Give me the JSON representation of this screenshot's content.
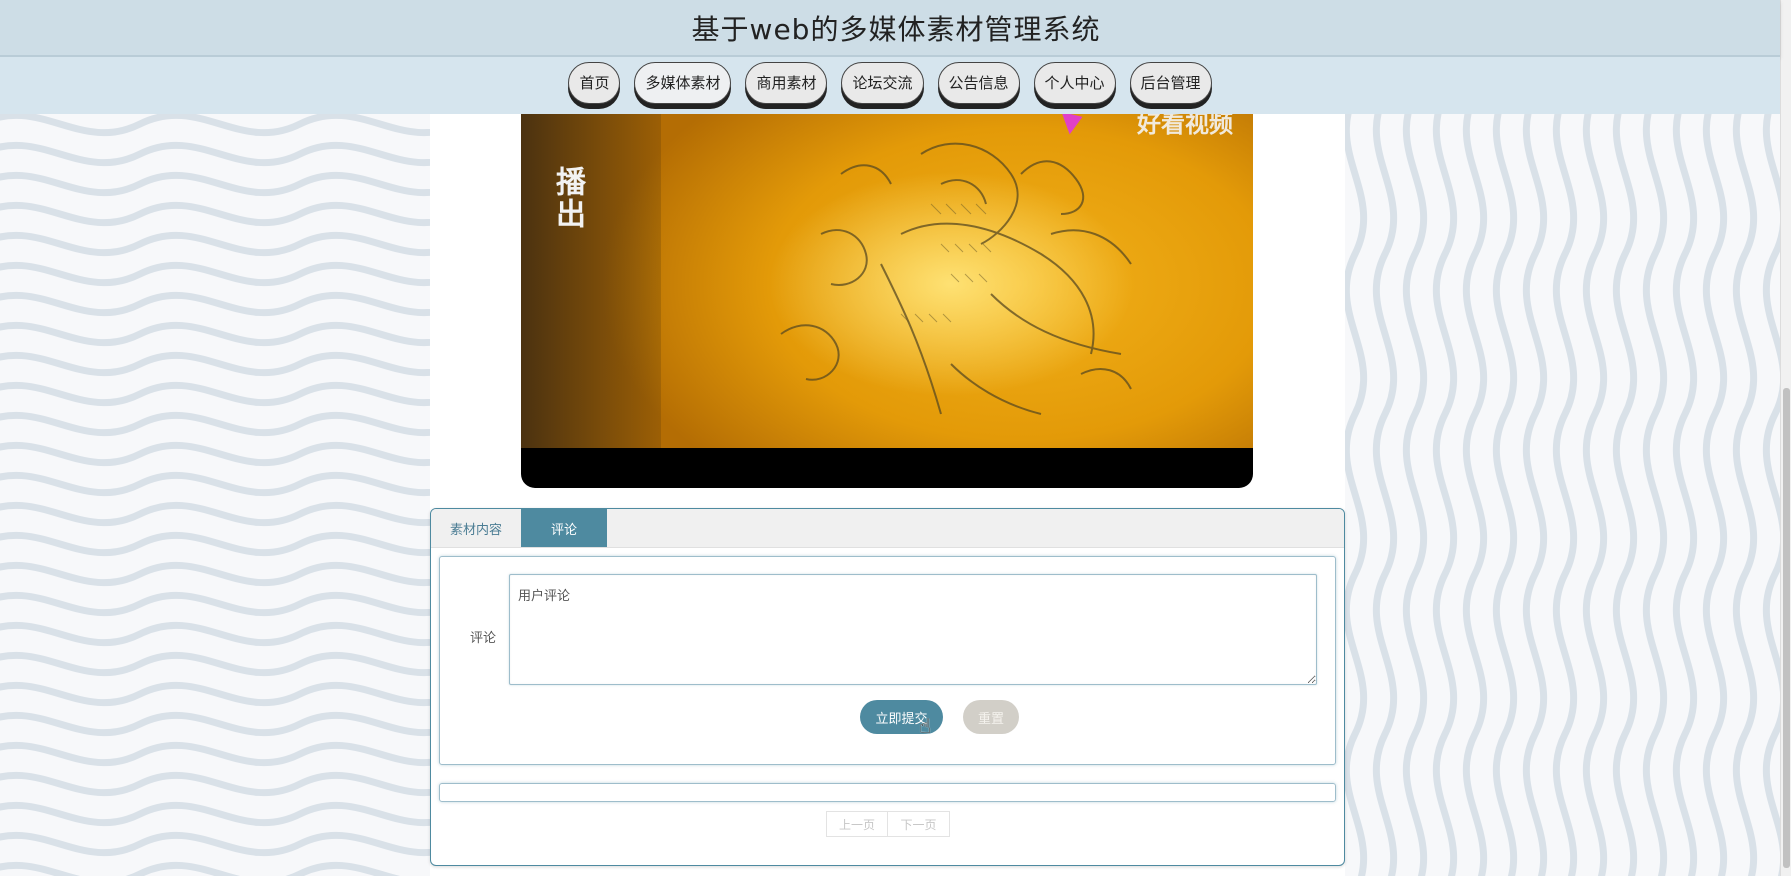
{
  "header": {
    "title": "基于web的多媒体素材管理系统"
  },
  "nav": {
    "items": [
      {
        "label": "首页"
      },
      {
        "label": "多媒体素材"
      },
      {
        "label": "商用素材"
      },
      {
        "label": "论坛交流"
      },
      {
        "label": "公告信息"
      },
      {
        "label": "个人中心"
      },
      {
        "label": "后台管理"
      }
    ]
  },
  "video": {
    "watermark": "好看视频",
    "caption": "播出"
  },
  "tabs": [
    {
      "label": "素材内容"
    },
    {
      "label": "评论"
    }
  ],
  "comment_form": {
    "label": "评论",
    "placeholder": "用户评论",
    "submit_label": "立即提交",
    "reset_label": "重置"
  },
  "pager": {
    "prev_label": "上一页",
    "next_label": "下一页"
  },
  "colors": {
    "accent": "#4e8aa0",
    "header_bg": "#cddde6",
    "nav_bg": "#d6e5ee",
    "reset_bg": "#d2cfc8"
  },
  "icons": {
    "cursor": "hand-pointer-icon"
  }
}
